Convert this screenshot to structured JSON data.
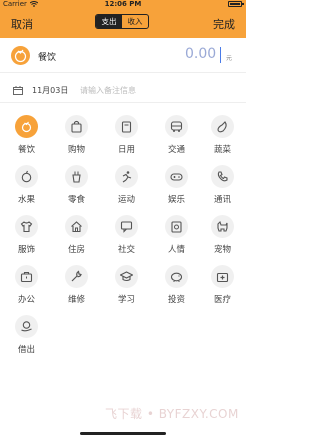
{
  "status": {
    "carrier": "Carrier",
    "time": "12:06 PM"
  },
  "nav": {
    "cancel": "取消",
    "done": "完成",
    "tab_expense": "支出",
    "tab_income": "收入"
  },
  "amount": {
    "category": "餐饮",
    "value": "0.00",
    "unit": "元"
  },
  "memo": {
    "date": "11月03日",
    "placeholder": "请输入备注信息"
  },
  "categories": [
    {
      "label": "餐饮",
      "icon": "dining-icon",
      "selected": true
    },
    {
      "label": "购物",
      "icon": "shopping-bag-icon"
    },
    {
      "label": "日用",
      "icon": "daily-use-icon"
    },
    {
      "label": "交通",
      "icon": "bus-icon"
    },
    {
      "label": "蔬菜",
      "icon": "eggplant-icon"
    },
    {
      "label": "水果",
      "icon": "apple-icon"
    },
    {
      "label": "零食",
      "icon": "snack-fries-icon"
    },
    {
      "label": "运动",
      "icon": "running-icon"
    },
    {
      "label": "娱乐",
      "icon": "gamepad-icon"
    },
    {
      "label": "通讯",
      "icon": "phone-icon"
    },
    {
      "label": "服饰",
      "icon": "tshirt-icon"
    },
    {
      "label": "住房",
      "icon": "house-icon"
    },
    {
      "label": "社交",
      "icon": "chat-icon"
    },
    {
      "label": "人情",
      "icon": "gift-card-icon"
    },
    {
      "label": "宠物",
      "icon": "dog-icon"
    },
    {
      "label": "办公",
      "icon": "briefcase-icon"
    },
    {
      "label": "维修",
      "icon": "wrench-icon"
    },
    {
      "label": "学习",
      "icon": "graduation-cap-icon"
    },
    {
      "label": "投资",
      "icon": "piggy-bank-icon"
    },
    {
      "label": "医疗",
      "icon": "medical-kit-icon"
    },
    {
      "label": "借出",
      "icon": "lend-icon"
    }
  ],
  "watermark": "飞下载 • BYFZXY.COM",
  "colors": {
    "accent": "#f7a23a",
    "amount_text": "#9aa9d6"
  }
}
